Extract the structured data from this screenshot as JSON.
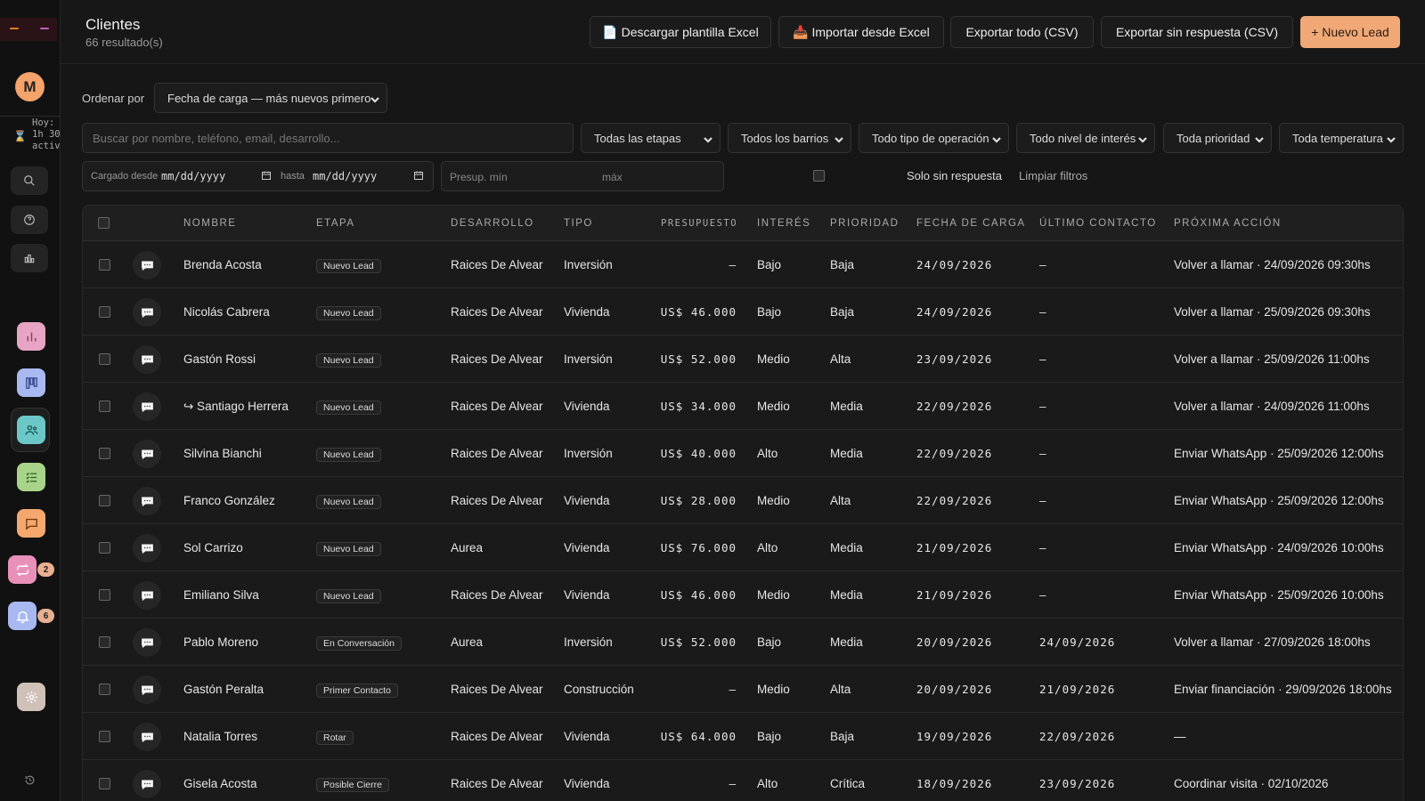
{
  "sidebar": {
    "avatar_initial": "M",
    "today_lines": [
      "Hoy:",
      "1h 30",
      "activ"
    ],
    "badge_reminders": "2",
    "badge_notifications": "6"
  },
  "header": {
    "title": "Clientes",
    "count": "66 resultado(s)",
    "btn_template": "📄 Descargar plantilla Excel",
    "btn_import": "📥 Importar desde Excel",
    "btn_export_all": "Exportar todo (CSV)",
    "btn_export_noresp": "Exportar sin respuesta (CSV)",
    "btn_new": "+ Nuevo Lead"
  },
  "filters": {
    "sort_label": "Ordenar por",
    "sort_value": "Fecha de carga — más nuevos primero",
    "search_placeholder": "Buscar por nombre, teléfono, email, desarrollo...",
    "stages": "Todas las etapas",
    "barrios": "Todos los barrios",
    "operacion": "Todo tipo de operación",
    "interes": "Todo nivel de interés",
    "prioridad": "Toda prioridad",
    "temperatura": "Toda temperatura",
    "cargado_desde": "Cargado desde",
    "date_placeholder": "mm/dd/yyyy",
    "hasta": "hasta",
    "presup_min": "Presup. mín",
    "max": "máx",
    "solo_sin_respuesta": "Solo sin respuesta",
    "limpiar": "Limpiar filtros"
  },
  "table": {
    "headers": [
      "NOMBRE",
      "ETAPA",
      "DESARROLLO",
      "TIPO",
      "PRESUPUESTO",
      "INTERÉS",
      "PRIORIDAD",
      "FECHA DE CARGA",
      "ÚLTIMO CONTACTO",
      "PRÓXIMA ACCIÓN"
    ],
    "rows": [
      {
        "nombre": "Brenda Acosta",
        "etapa": "Nuevo Lead",
        "desarrollo": "Raices De Alvear",
        "tipo": "Inversión",
        "presupuesto": "—",
        "interes": "Bajo",
        "prioridad": "Baja",
        "fecha": "24/09/2026",
        "ultimo": "—",
        "proxima": "Volver a llamar · 24/09/2026 09:30hs"
      },
      {
        "nombre": "Nicolás Cabrera",
        "etapa": "Nuevo Lead",
        "desarrollo": "Raices De Alvear",
        "tipo": "Vivienda",
        "presupuesto": "US$ 46.000",
        "interes": "Bajo",
        "prioridad": "Baja",
        "fecha": "24/09/2026",
        "ultimo": "—",
        "proxima": "Volver a llamar · 25/09/2026 09:30hs"
      },
      {
        "nombre": "Gastón Rossi",
        "etapa": "Nuevo Lead",
        "desarrollo": "Raices De Alvear",
        "tipo": "Inversión",
        "presupuesto": "US$ 52.000",
        "interes": "Medio",
        "prioridad": "Alta",
        "fecha": "23/09/2026",
        "ultimo": "—",
        "proxima": "Volver a llamar · 25/09/2026 11:00hs"
      },
      {
        "nombre": "↪ Santiago Herrera",
        "etapa": "Nuevo Lead",
        "desarrollo": "Raices De Alvear",
        "tipo": "Vivienda",
        "presupuesto": "US$ 34.000",
        "interes": "Medio",
        "prioridad": "Media",
        "fecha": "22/09/2026",
        "ultimo": "—",
        "proxima": "Volver a llamar · 24/09/2026 11:00hs"
      },
      {
        "nombre": "Silvina Bianchi",
        "etapa": "Nuevo Lead",
        "desarrollo": "Raices De Alvear",
        "tipo": "Inversión",
        "presupuesto": "US$ 40.000",
        "interes": "Alto",
        "prioridad": "Media",
        "fecha": "22/09/2026",
        "ultimo": "—",
        "proxima": "Enviar WhatsApp · 25/09/2026 12:00hs"
      },
      {
        "nombre": "Franco González",
        "etapa": "Nuevo Lead",
        "desarrollo": "Raices De Alvear",
        "tipo": "Vivienda",
        "presupuesto": "US$ 28.000",
        "interes": "Medio",
        "prioridad": "Alta",
        "fecha": "22/09/2026",
        "ultimo": "—",
        "proxima": "Enviar WhatsApp · 25/09/2026 12:00hs"
      },
      {
        "nombre": "Sol Carrizo",
        "etapa": "Nuevo Lead",
        "desarrollo": "Aurea",
        "tipo": "Vivienda",
        "presupuesto": "US$ 76.000",
        "interes": "Alto",
        "prioridad": "Media",
        "fecha": "21/09/2026",
        "ultimo": "—",
        "proxima": "Enviar WhatsApp · 24/09/2026 10:00hs"
      },
      {
        "nombre": "Emiliano Silva",
        "etapa": "Nuevo Lead",
        "desarrollo": "Raices De Alvear",
        "tipo": "Vivienda",
        "presupuesto": "US$ 46.000",
        "interes": "Medio",
        "prioridad": "Media",
        "fecha": "21/09/2026",
        "ultimo": "—",
        "proxima": "Enviar WhatsApp · 25/09/2026 10:00hs"
      },
      {
        "nombre": "Pablo Moreno",
        "etapa": "En Conversación",
        "desarrollo": "Aurea",
        "tipo": "Inversión",
        "presupuesto": "US$ 52.000",
        "interes": "Bajo",
        "prioridad": "Media",
        "fecha": "20/09/2026",
        "ultimo": "24/09/2026",
        "proxima": "Volver a llamar · 27/09/2026 18:00hs"
      },
      {
        "nombre": "Gastón Peralta",
        "etapa": "Primer Contacto",
        "desarrollo": "Raices De Alvear",
        "tipo": "Construcción",
        "presupuesto": "—",
        "interes": "Medio",
        "prioridad": "Alta",
        "fecha": "20/09/2026",
        "ultimo": "21/09/2026",
        "proxima": "Enviar financiación · 29/09/2026 18:00hs"
      },
      {
        "nombre": "Natalia Torres",
        "etapa": "Rotar",
        "desarrollo": "Raices De Alvear",
        "tipo": "Vivienda",
        "presupuesto": "US$ 64.000",
        "interes": "Bajo",
        "prioridad": "Baja",
        "fecha": "19/09/2026",
        "ultimo": "22/09/2026",
        "proxima": "—"
      },
      {
        "nombre": "Gisela Acosta",
        "etapa": "Posible Cierre",
        "desarrollo": "Raices De Alvear",
        "tipo": "Vivienda",
        "presupuesto": "—",
        "interes": "Alto",
        "prioridad": "Crítica",
        "fecha": "18/09/2026",
        "ultimo": "23/09/2026",
        "proxima": "Coordinar visita · 02/10/2026"
      }
    ]
  }
}
